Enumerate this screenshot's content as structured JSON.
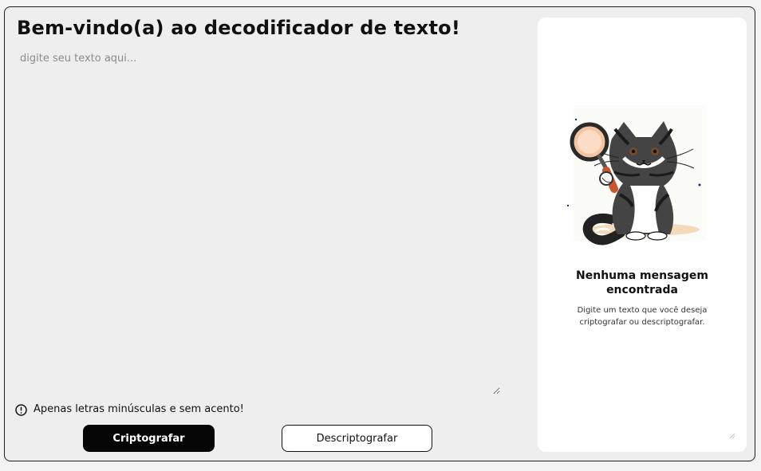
{
  "header": {
    "title": "Bem-vindo(a) ao decodificador de texto!"
  },
  "editor": {
    "placeholder": "digite seu texto aqui...",
    "value": ""
  },
  "hint": {
    "icon": "warning-icon",
    "text": "Apenas letras minúsculas e sem acento!"
  },
  "actions": {
    "encrypt_label": "Criptografar",
    "decrypt_label": "Descriptografar"
  },
  "output": {
    "image": "cat-with-magnifying-glass",
    "title": "Nenhuma mensagem encontrada",
    "subtitle": "Digite um texto que você deseja criptografar ou descriptografar."
  },
  "colors": {
    "page_background": "#eeeeee",
    "panel_background": "#ffffff",
    "primary_button": "#050505",
    "text": "#111111"
  }
}
